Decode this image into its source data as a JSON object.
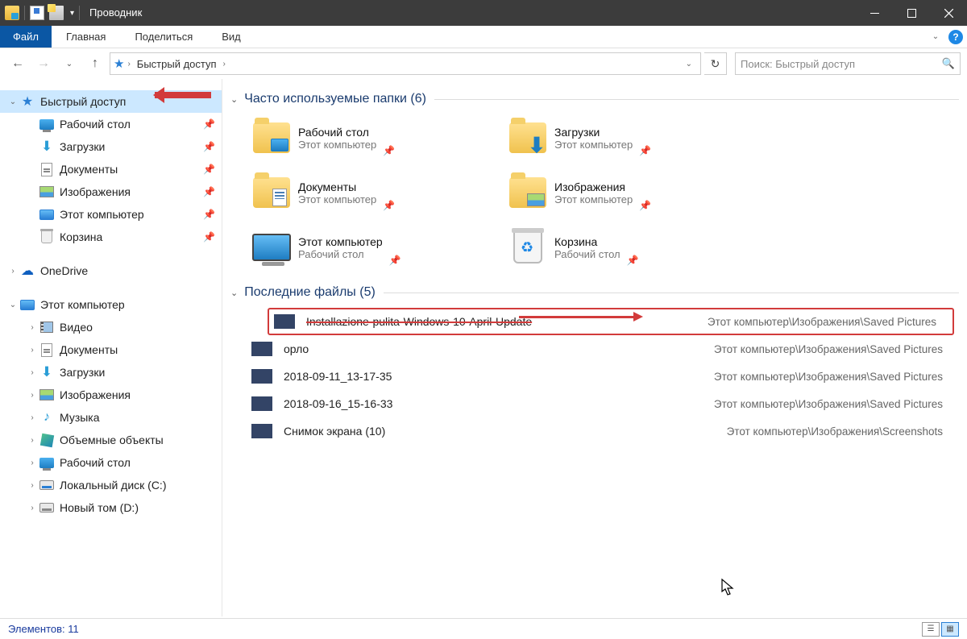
{
  "window": {
    "title": "Проводник"
  },
  "ribbon": {
    "file": "Файл",
    "tabs": [
      "Главная",
      "Поделиться",
      "Вид"
    ]
  },
  "nav": {
    "breadcrumb": "Быстрый доступ",
    "search_placeholder": "Поиск: Быстрый доступ"
  },
  "sidebar": {
    "quick_access": "Быстрый доступ",
    "items": [
      {
        "label": "Рабочий стол"
      },
      {
        "label": "Загрузки"
      },
      {
        "label": "Документы"
      },
      {
        "label": "Изображения"
      },
      {
        "label": "Этот компьютер"
      },
      {
        "label": "Корзина"
      }
    ],
    "onedrive": "OneDrive",
    "this_pc": "Этот компьютер",
    "pc_items": [
      {
        "label": "Видео"
      },
      {
        "label": "Документы"
      },
      {
        "label": "Загрузки"
      },
      {
        "label": "Изображения"
      },
      {
        "label": "Музыка"
      },
      {
        "label": "Объемные объекты"
      },
      {
        "label": "Рабочий стол"
      },
      {
        "label": "Локальный диск (C:)"
      },
      {
        "label": "Новый том (D:)"
      }
    ]
  },
  "sections": {
    "frequent": "Часто используемые папки (6)",
    "recent": "Последние файлы (5)"
  },
  "folders": [
    {
      "name": "Рабочий стол",
      "sub": "Этот компьютер"
    },
    {
      "name": "Загрузки",
      "sub": "Этот компьютер"
    },
    {
      "name": "Документы",
      "sub": "Этот компьютер"
    },
    {
      "name": "Изображения",
      "sub": "Этот компьютер"
    },
    {
      "name": "Этот компьютер",
      "sub": "Рабочий стол"
    },
    {
      "name": "Корзина",
      "sub": "Рабочий стол"
    }
  ],
  "files": [
    {
      "name": "Installazione-pulita-Windows-10-April-Update",
      "path": "Этот компьютер\\Изображения\\Saved Pictures"
    },
    {
      "name": "орло",
      "path": "Этот компьютер\\Изображения\\Saved Pictures"
    },
    {
      "name": "2018-09-11_13-17-35",
      "path": "Этот компьютер\\Изображения\\Saved Pictures"
    },
    {
      "name": "2018-09-16_15-16-33",
      "path": "Этот компьютер\\Изображения\\Saved Pictures"
    },
    {
      "name": "Снимок экрана (10)",
      "path": "Этот компьютер\\Изображения\\Screenshots"
    }
  ],
  "status": {
    "items": "Элементов: 11"
  }
}
